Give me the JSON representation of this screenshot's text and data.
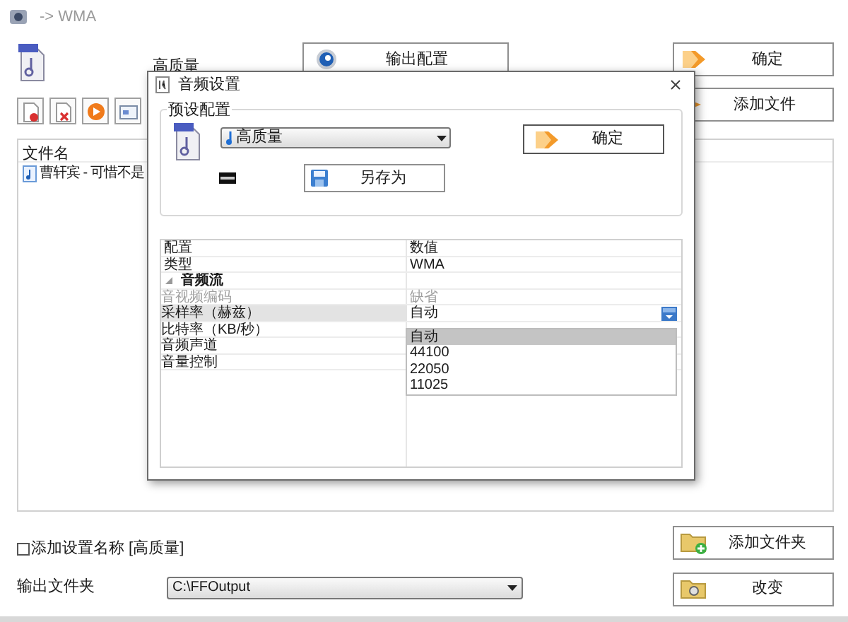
{
  "main_window": {
    "title": "-> WMA",
    "preset_name": "高质量",
    "buttons": {
      "output_config": "输出配置",
      "ok": "确定",
      "add_file": "添加文件",
      "add_folder": "添加文件夹",
      "change": "改变"
    },
    "file_list": {
      "columns": [
        "文件名"
      ],
      "rows": [
        "曹轩宾 - 可惜不是"
      ]
    },
    "add_name_checkbox": {
      "label": "添加设置名称 [高质量]",
      "checked": false
    },
    "output_folder": {
      "label": "输出文件夹",
      "value": "C:\\FFOutput"
    }
  },
  "dialog": {
    "title": "音频设置",
    "preset_group": {
      "title": "预设配置",
      "preset": "高质量",
      "ok": "确定",
      "save_as": "另存为"
    },
    "properties": {
      "columns": [
        "配置",
        "数值"
      ],
      "rows": [
        {
          "kind": "item",
          "name": "类型",
          "value": "WMA",
          "disabled": false,
          "selected": false
        },
        {
          "kind": "category",
          "name": "音频流",
          "expanded": true,
          "children": [
            {
              "kind": "item",
              "name": "音视频编码",
              "value": "缺省",
              "disabled": true,
              "selected": false
            },
            {
              "kind": "item",
              "name": "采样率（赫兹）",
              "value": "自动",
              "disabled": false,
              "selected": true,
              "options": [
                {
                  "label": "自动",
                  "selected": true
                },
                {
                  "label": "44100",
                  "selected": false
                },
                {
                  "label": "22050",
                  "selected": false
                },
                {
                  "label": "11025",
                  "selected": false
                }
              ]
            },
            {
              "kind": "item",
              "name": "比特率（KB/秒）",
              "disabled": false,
              "selected": false
            },
            {
              "kind": "item",
              "name": "音频声道",
              "disabled": false,
              "selected": false
            },
            {
              "kind": "item",
              "name": "音量控制",
              "disabled": false,
              "selected": false
            }
          ]
        }
      ]
    }
  }
}
